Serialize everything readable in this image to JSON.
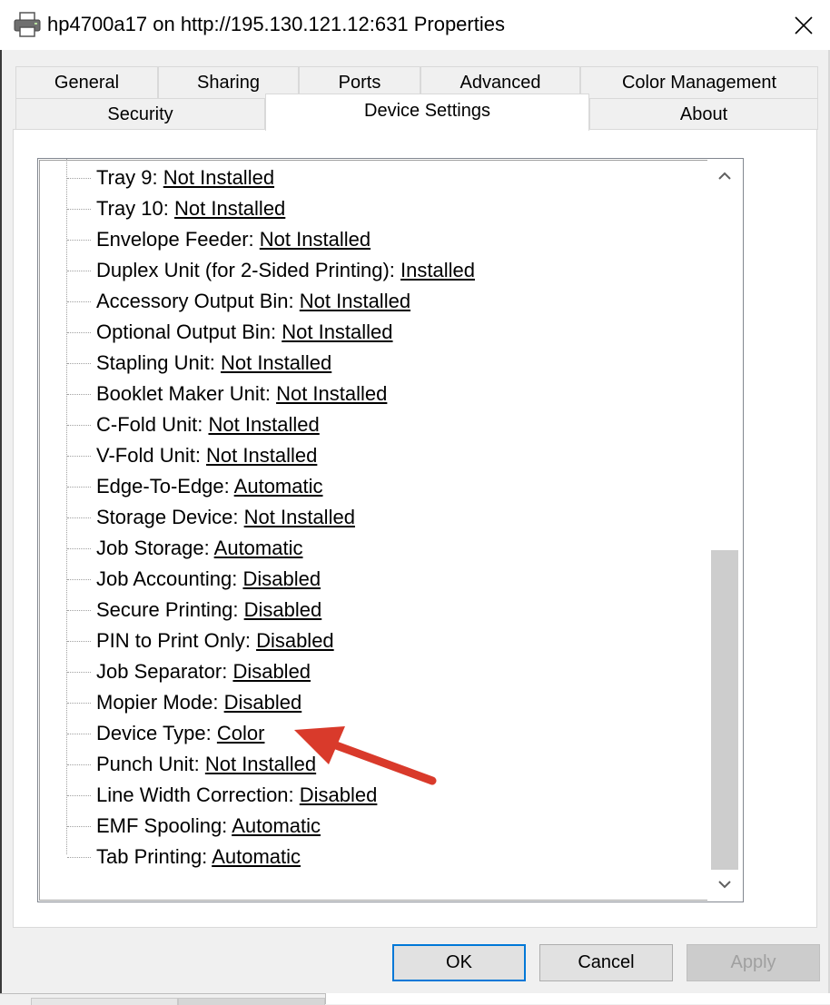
{
  "window": {
    "title": "hp4700a17 on http://195.130.121.12:631 Properties",
    "icon": "printer-icon",
    "close_icon": "close-icon"
  },
  "tabs": {
    "row1": [
      "General",
      "Sharing",
      "Ports",
      "Advanced",
      "Color Management"
    ],
    "row2": [
      "Security",
      "Device Settings",
      "About"
    ],
    "active": "Device Settings"
  },
  "tree": {
    "items": [
      {
        "label": "Tray 9: ",
        "value": "Not Installed"
      },
      {
        "label": "Tray 10: ",
        "value": "Not Installed"
      },
      {
        "label": "Envelope Feeder: ",
        "value": "Not Installed"
      },
      {
        "label": "Duplex Unit (for 2-Sided Printing): ",
        "value": "Installed"
      },
      {
        "label": "Accessory Output Bin: ",
        "value": "Not Installed"
      },
      {
        "label": "Optional Output Bin: ",
        "value": "Not Installed"
      },
      {
        "label": "Stapling Unit: ",
        "value": "Not Installed"
      },
      {
        "label": "Booklet Maker Unit: ",
        "value": "Not Installed"
      },
      {
        "label": "C-Fold Unit: ",
        "value": "Not Installed"
      },
      {
        "label": "V-Fold Unit: ",
        "value": "Not Installed"
      },
      {
        "label": "Edge-To-Edge: ",
        "value": "Automatic"
      },
      {
        "label": "Storage Device: ",
        "value": "Not Installed"
      },
      {
        "label": "Job Storage: ",
        "value": "Automatic"
      },
      {
        "label": "Job Accounting: ",
        "value": "Disabled"
      },
      {
        "label": "Secure Printing: ",
        "value": "Disabled"
      },
      {
        "label": "PIN to Print Only: ",
        "value": "Disabled"
      },
      {
        "label": "Job Separator: ",
        "value": "Disabled"
      },
      {
        "label": "Mopier Mode: ",
        "value": "Disabled"
      },
      {
        "label": "Device Type: ",
        "value": "Color"
      },
      {
        "label": "Punch Unit: ",
        "value": "Not Installed"
      },
      {
        "label": "Line Width Correction: ",
        "value": "Disabled"
      },
      {
        "label": "EMF Spooling: ",
        "value": "Automatic"
      },
      {
        "label": "Tab Printing: ",
        "value": "Automatic"
      }
    ]
  },
  "scrollbar": {
    "up_icon": "chevron-up-icon",
    "down_icon": "chevron-down-icon",
    "position": "bottom"
  },
  "buttons": {
    "ok": "OK",
    "cancel": "Cancel",
    "apply": "Apply"
  },
  "annotation": {
    "icon": "red-arrow-icon",
    "color": "#d93a2b",
    "points_to": "Device Type"
  },
  "colors": {
    "accent": "#0078d7",
    "dialog_bg": "#f0f0f0",
    "thumb": "#cdcdcd"
  }
}
